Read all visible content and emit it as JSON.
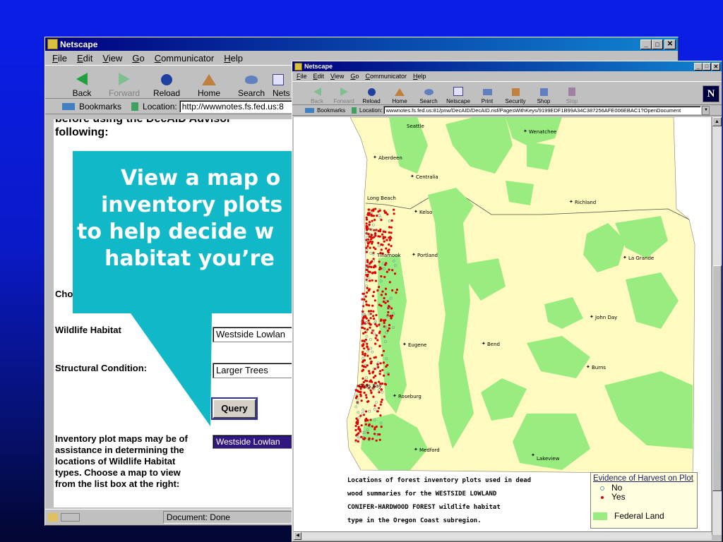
{
  "back_window": {
    "title": "Netscape",
    "menu": [
      "File",
      "Edit",
      "View",
      "Go",
      "Communicator",
      "Help"
    ],
    "toolbar": [
      "Back",
      "Forward",
      "Reload",
      "Home",
      "Search",
      "Nets"
    ],
    "bookmarks_label": "Bookmarks",
    "location_label": "Location:",
    "location_url": "http://wwwnotes.fs.fed.us:8",
    "heading_partial": "before using the DecAID Advisor",
    "heading_following": "following:",
    "choose_label": "Cho",
    "wildlife_label": "Wildlife Habitat",
    "wildlife_value": "Westside Lowlan",
    "structural_label": "Structural Condition:",
    "structural_value": "Larger Trees",
    "query_button": "Query",
    "inventory_text": [
      "Inventory plot maps may be of",
      "assistance in determining the",
      "locations of Wildlife Habitat",
      "types. Choose a map to view",
      "from the list box at the right:"
    ],
    "inventory_value": "Westside Lowlan",
    "status_text": "Document: Done"
  },
  "callout": {
    "lines": [
      "View a map o",
      "inventory plots",
      "to help decide w",
      "habitat you’re"
    ],
    "color": "#10b8c8"
  },
  "front_window": {
    "title": "Netscape",
    "menu": [
      "File",
      "Edit",
      "View",
      "Go",
      "Communicator",
      "Help"
    ],
    "toolbar": [
      "Back",
      "Forward",
      "Reload",
      "Home",
      "Search",
      "Netscape",
      "Print",
      "Security",
      "Shop",
      "Stop"
    ],
    "bookmarks_label": "Bookmarks",
    "location_label": "Location:",
    "location_url": "wwwnotes.fs.fed.us:81/pnw/DecAID/DecAID.nsf/PagesWithKeys/9199EDF1B99A34C387256AFE006EBAC1?OpenDocument",
    "cities": [
      "Seattle",
      "Wenatchee",
      "Aberdeen",
      "Centralia",
      "Long Beach",
      "Kelso",
      "Richland",
      "Tillamook",
      "Portland",
      "La Grande",
      "John Day",
      "Eugene",
      "Bend",
      "Burns",
      "Coos Bay",
      "Roseburg",
      "Medford",
      "Lakeview"
    ],
    "caption": [
      "Locations of forest inventory plots used in dead",
      "wood summaries for the WESTSIDE LOWLAND",
      "CONIFER-HARDWOOD FOREST wildlife habitat",
      "type in the Oregon Coast subregion."
    ],
    "legend": {
      "title": "Evidence of Harvest on Plot",
      "no": "No",
      "yes": "Yes",
      "federal": "Federal Land"
    }
  }
}
